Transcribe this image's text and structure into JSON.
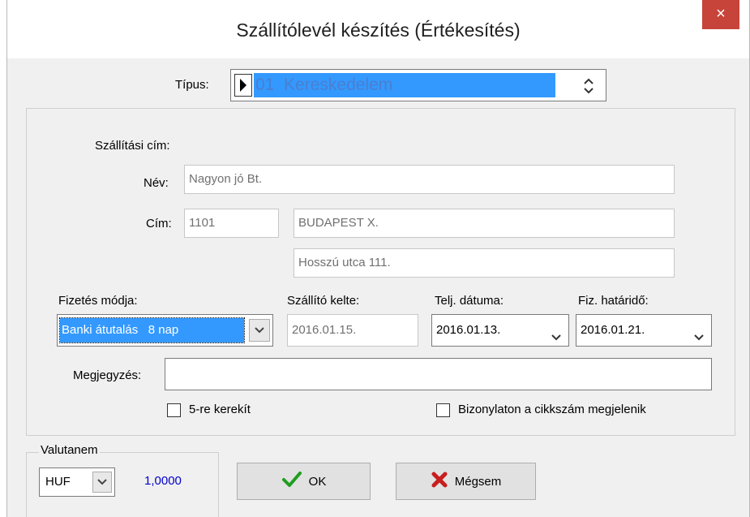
{
  "window": {
    "title": "Szállítólevél készítés (Értékesítés)",
    "close": "×"
  },
  "tipus": {
    "label": "Típus:",
    "value": "01  Kereskedelem",
    "spin_icon": "spin-updown-icon"
  },
  "address": {
    "section_label": "Szállítási cím:",
    "name_label": "Név:",
    "name_value": "Nagyon jó Bt.",
    "address_label": "Cím:",
    "zip_value": "1101",
    "city_value": "BUDAPEST X.",
    "street_value": "Hosszú utca 111."
  },
  "payment": {
    "method_label": "Fizetés módja:",
    "method_value": "Banki átutalás   8 nap",
    "issue_label": "Szállító kelte:",
    "issue_value": "2016.01.15.",
    "perf_label": "Telj. dátuma:",
    "perf_value": "2016.01.13.",
    "due_label": "Fiz. határidő:",
    "due_value": "2016.01.21."
  },
  "note": {
    "label": "Megjegyzés:",
    "value": ""
  },
  "options": {
    "round5_label": "5-re kerekít",
    "itemcode_label": "Bizonylaton a cikkszám megjelenik"
  },
  "currency": {
    "group_label": "Valutanem",
    "value": "HUF",
    "rate": "1,0000"
  },
  "buttons": {
    "ok_label": "OK",
    "cancel_label": "Mégsem"
  },
  "colors": {
    "selection": "#3399ff",
    "rate_text": "#0000cc",
    "ok_check": "#1f9d1f",
    "cancel_x": "#c81e1e",
    "close_bg": "#c7443a"
  }
}
